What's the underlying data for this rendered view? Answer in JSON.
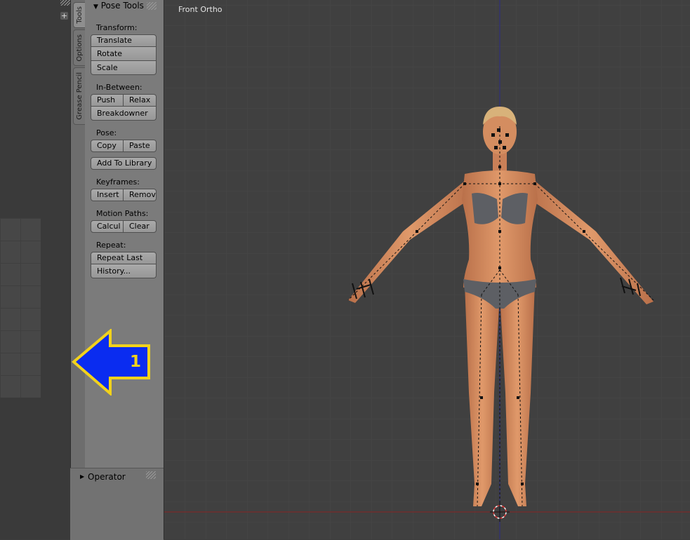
{
  "left_area": {
    "plus_icon": "+"
  },
  "tabs": [
    {
      "label": "Tools",
      "active": true
    },
    {
      "label": "Options",
      "active": false
    },
    {
      "label": "Grease Pencil",
      "active": false
    }
  ],
  "panel": {
    "title": "Pose Tools",
    "sections": {
      "transform": {
        "label": "Transform:",
        "translate": "Translate",
        "rotate": "Rotate",
        "scale": "Scale"
      },
      "in_between": {
        "label": "In-Between:",
        "push": "Push",
        "relax": "Relax",
        "breakdowner": "Breakdowner"
      },
      "pose": {
        "label": "Pose:",
        "copy": "Copy",
        "paste": "Paste",
        "add_to_library": "Add To Library"
      },
      "keyframes": {
        "label": "Keyframes:",
        "insert": "Insert",
        "remove": "Remov"
      },
      "motion_paths": {
        "label": "Motion Paths:",
        "calculate": "Calcul",
        "clear": "Clear"
      },
      "repeat": {
        "label": "Repeat:",
        "repeat_last": "Repeat Last",
        "history": "History..."
      }
    }
  },
  "operator": {
    "label": "Operator"
  },
  "viewport": {
    "label": "Front Ortho"
  },
  "callout": {
    "number": "1",
    "fill_color": "#0a2cf0",
    "border_color": "#f2d21b"
  },
  "colors": {
    "viewport_bg": "#404040",
    "panel_bg": "#7b7b7b",
    "x_axis": "#8a2a2a",
    "z_axis": "#2a2a8a"
  }
}
